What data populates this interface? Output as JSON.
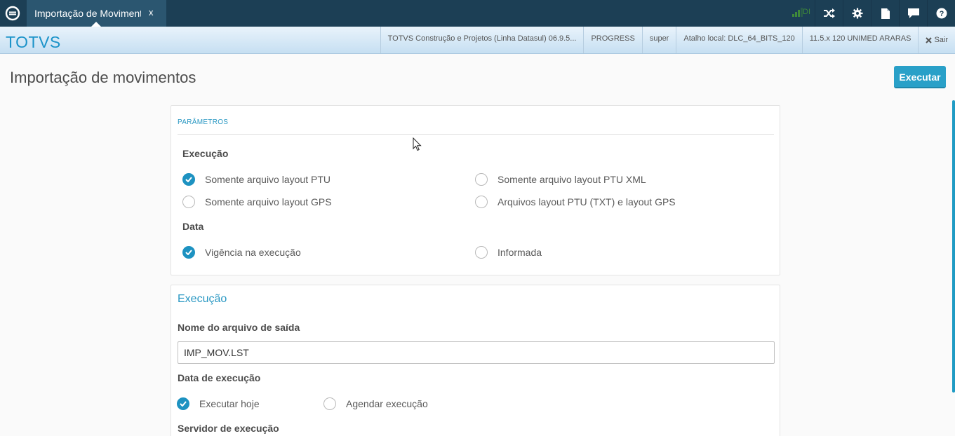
{
  "topbar": {
    "tab_label": "Importação de Movimentos",
    "tab_close": "x",
    "signal_text": "DI",
    "icons": [
      "shuffle-icon",
      "gear-icon",
      "document-icon",
      "chat-icon",
      "help-icon"
    ]
  },
  "header": {
    "brand": "TOTVS",
    "product": "TOTVS Construção e Projetos (Linha Datasul) 06.9.5...",
    "database": "PROGRESS",
    "user": "super",
    "shortcut": "Atalho local: DLC_64_BITS_120",
    "company": "11.5.x 120 UNIMED ARARAS",
    "logout": "Sair"
  },
  "page": {
    "title": "Importação de movimentos",
    "execute_button": "Executar"
  },
  "parameters": {
    "section_label": "PARÂMETROS",
    "execution_title": "Execução",
    "execution_options": [
      {
        "label": "Somente arquivo layout PTU",
        "checked": true
      },
      {
        "label": "Somente arquivo layout PTU XML",
        "checked": false
      },
      {
        "label": "Somente arquivo layout GPS",
        "checked": false
      },
      {
        "label": "Arquivos layout PTU (TXT) e layout GPS",
        "checked": false
      }
    ],
    "date_title": "Data",
    "date_options": [
      {
        "label": "Vigência na execução",
        "checked": true
      },
      {
        "label": "Informada",
        "checked": false
      }
    ]
  },
  "execution": {
    "title": "Execução",
    "output_file_label": "Nome do arquivo de saída",
    "output_file_value": "IMP_MOV.LST",
    "exec_date_label": "Data de execução",
    "exec_date_options": [
      {
        "label": "Executar hoje",
        "checked": true
      },
      {
        "label": "Agendar execução",
        "checked": false
      }
    ],
    "server_label": "Servidor de execução"
  },
  "colors": {
    "topbar": "#1c3f55",
    "brand": "#1c93c9",
    "accent": "#29a0c8"
  }
}
